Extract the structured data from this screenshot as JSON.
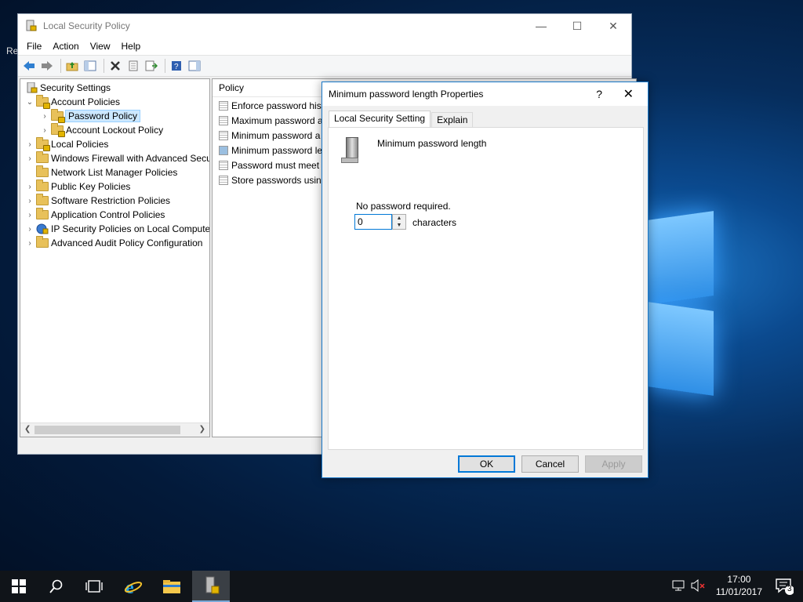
{
  "desktop": {
    "partial_text": "Re"
  },
  "mmc": {
    "title": "Local Security Policy",
    "menu": [
      "File",
      "Action",
      "View",
      "Help"
    ],
    "toolbar_icons": [
      "back-arrow-icon",
      "forward-arrow-icon",
      "up-folder-icon",
      "show-hide-tree-icon",
      "delete-icon",
      "properties-icon",
      "export-list-icon",
      "help-icon",
      "action-pane-icon"
    ],
    "tree": {
      "root": "Security Settings",
      "account_policies": "Account Policies",
      "password_policy": "Password Policy",
      "account_lockout_policy": "Account Lockout Policy",
      "local_policies": "Local Policies",
      "windows_firewall": "Windows Firewall with Advanced Secu",
      "network_list": "Network List Manager Policies",
      "public_key": "Public Key Policies",
      "software_restriction": "Software Restriction Policies",
      "application_control": "Application Control Policies",
      "ip_security": "IP Security Policies on Local Compute",
      "advanced_audit": "Advanced Audit Policy Configuration"
    },
    "list": {
      "column": "Policy",
      "rows": [
        "Enforce password histo",
        "Maximum password a",
        "Minimum password a",
        "Minimum password le",
        "Password must meet c",
        "Store passwords using"
      ]
    }
  },
  "dialog": {
    "title": "Minimum password length Properties",
    "help": "?",
    "close": "✕",
    "tabs": [
      "Local Security Setting",
      "Explain"
    ],
    "setting_name": "Minimum password length",
    "hint": "No password required.",
    "value": "0",
    "unit": "characters",
    "buttons": {
      "ok": "OK",
      "cancel": "Cancel",
      "apply": "Apply"
    }
  },
  "taskbar": {
    "time": "17:00",
    "date": "11/01/2017",
    "notification_count": "3"
  }
}
